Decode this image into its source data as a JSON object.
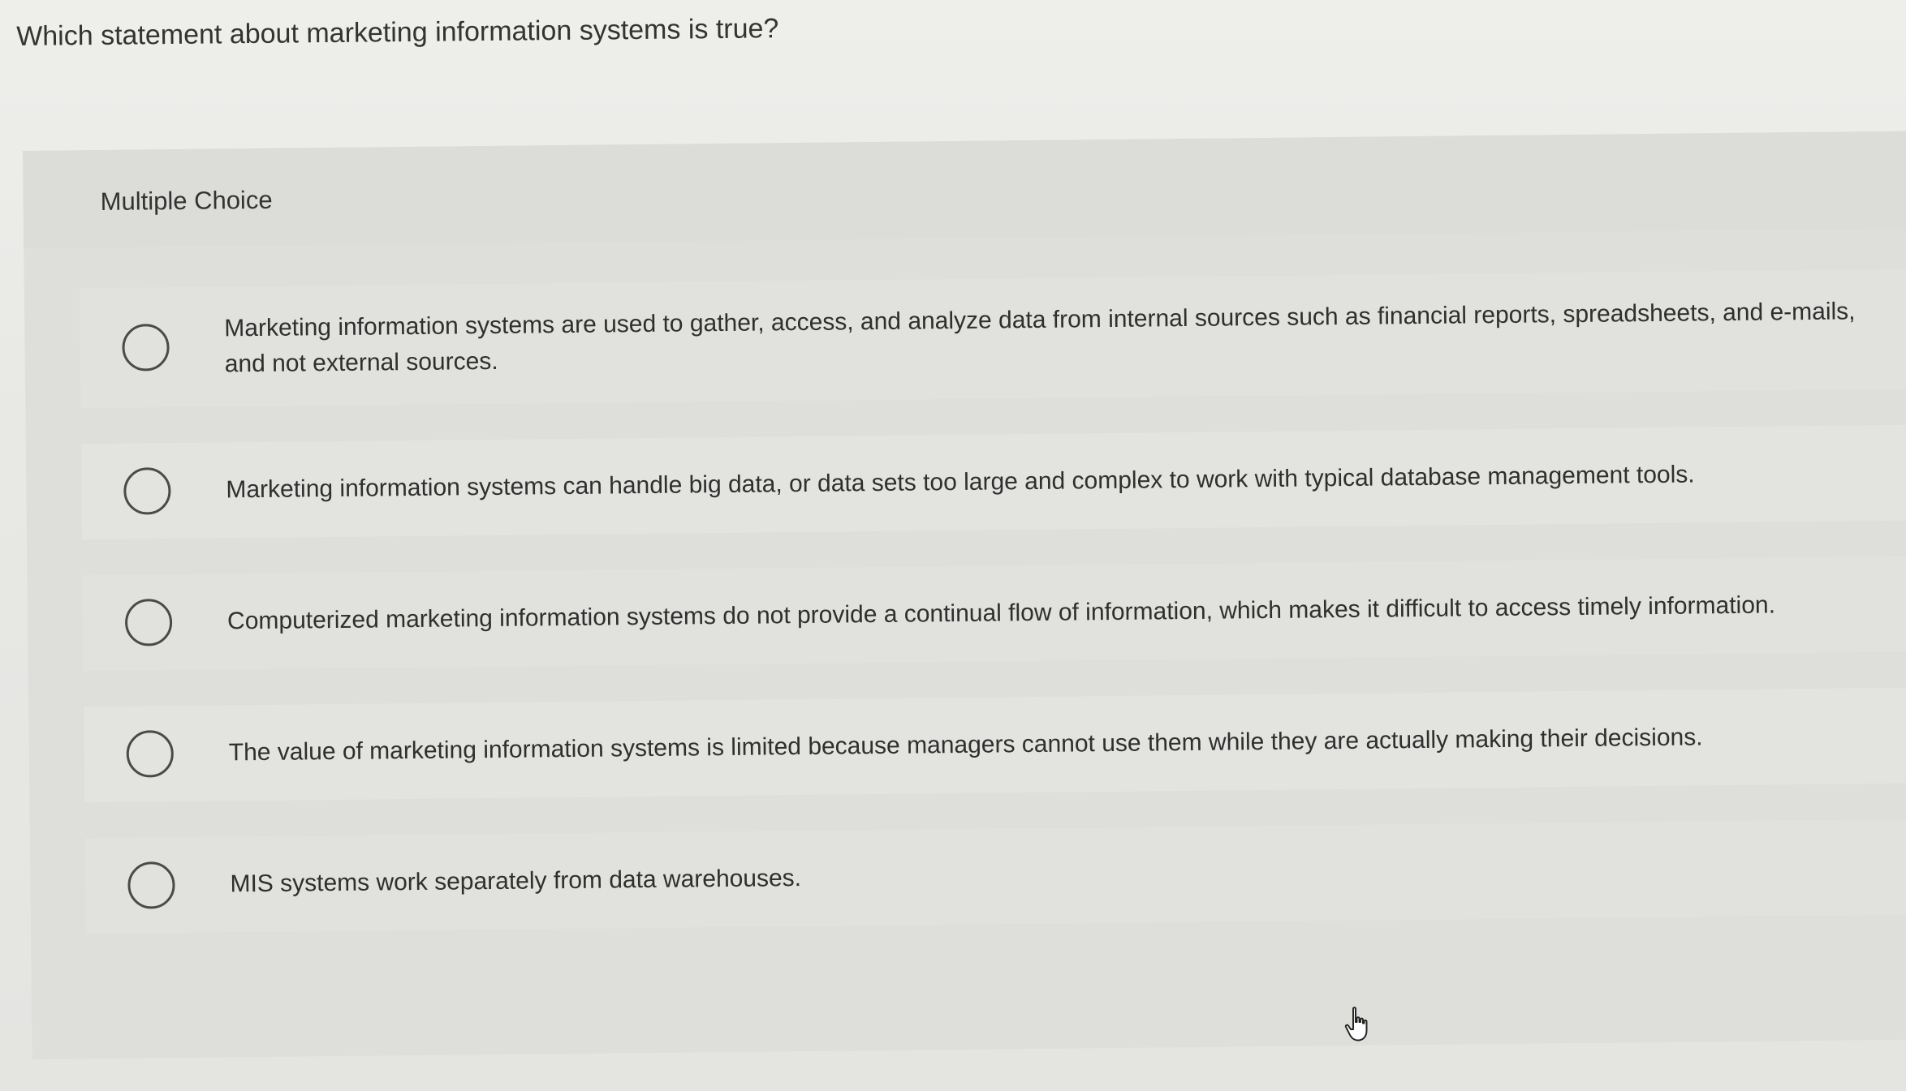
{
  "question": {
    "text": "Which statement about marketing information systems is true?"
  },
  "card": {
    "type_label": "Multiple Choice"
  },
  "choices": [
    {
      "text": "Marketing information systems are used to gather, access, and analyze data from internal sources such as financial reports, spreadsheets, and e-mails, and not external sources.",
      "selected": false
    },
    {
      "text": "Marketing information systems can handle big data, or data sets too large and complex to work with typical database management tools.",
      "selected": false
    },
    {
      "text": "Computerized marketing information systems do not provide a continual flow of information, which makes it difficult to access timely information.",
      "selected": false
    },
    {
      "text": "The value of marketing information systems is limited because managers cannot use them while they are actually making their decisions.",
      "selected": false
    },
    {
      "text": "MIS systems work separately from data warehouses.",
      "selected": false
    }
  ],
  "icons": {
    "radio": "radio-unchecked-icon",
    "cursor": "hand-pointer-icon"
  }
}
